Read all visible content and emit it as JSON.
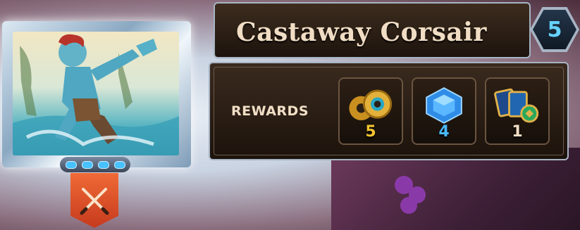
{
  "card": {
    "name": "Castaway Corsair",
    "level": "5",
    "gem_count": 4,
    "banner_icon": "crossed-swords-icon"
  },
  "rewards": {
    "label": "REWARDS",
    "items": [
      {
        "icon": "coins-icon",
        "count": "5",
        "color": "#f5c430"
      },
      {
        "icon": "gem-icon",
        "count": "4",
        "color": "#4ab8ff"
      },
      {
        "icon": "cards-icon",
        "count": "1",
        "color": "#f2dfc7"
      }
    ]
  },
  "colors": {
    "frame": "#a7b4c4",
    "panel": "#2a1d14",
    "level": "#66d2ff"
  }
}
